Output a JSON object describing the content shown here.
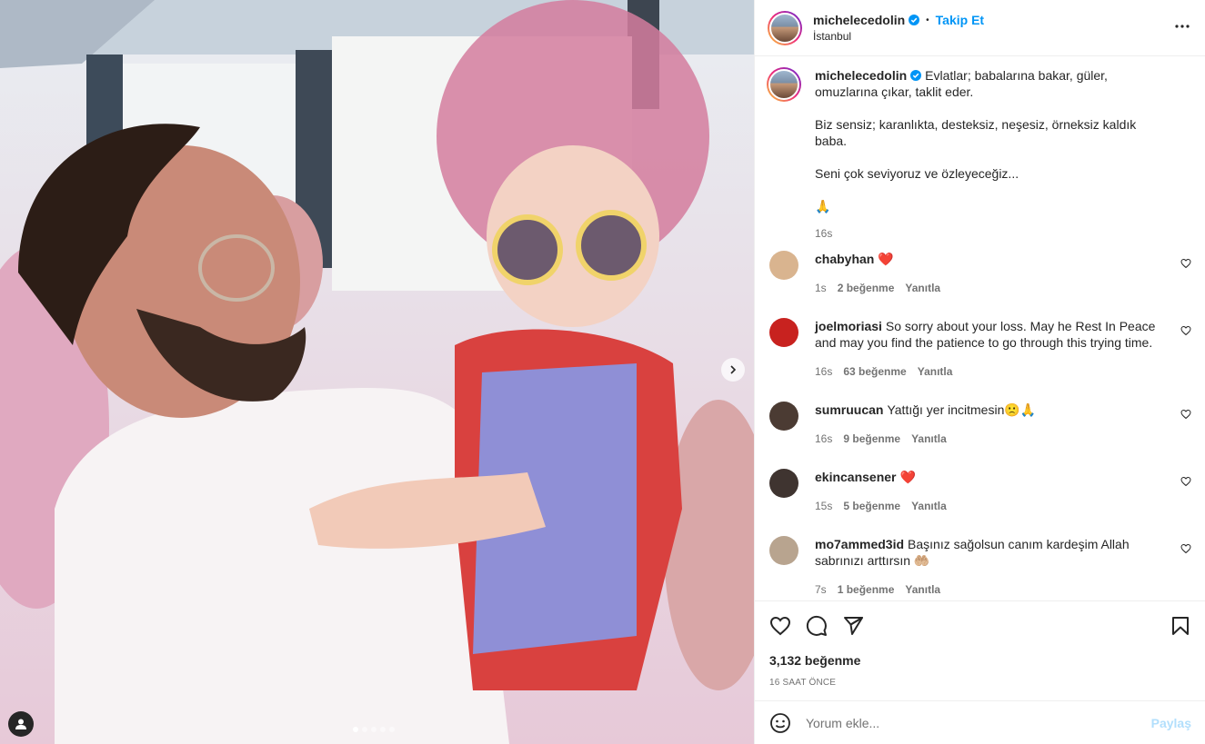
{
  "post": {
    "username": "michelecedolin",
    "follow_label": "Takip Et",
    "location": "İstanbul"
  },
  "caption": {
    "username": "michelecedolin",
    "line1": "Evlatlar; babalarına bakar, güler, omuzlarına çıkar, taklit eder.",
    "line2": "Biz sensiz; karanlıkta, desteksiz, neşesiz, örneksiz kaldık baba.",
    "line3": "Seni çok seviyoruz ve özleyeceğiz...",
    "emoji": "🙏",
    "time": "16s"
  },
  "comments": [
    {
      "username": "chabyhan",
      "text": "❤️",
      "time": "1s",
      "likes": "2 beğenme",
      "reply": "Yanıtla"
    },
    {
      "username": "joelmoriasi",
      "text": "So sorry about your loss. May he Rest In Peace and may you find the patience to go through this trying time.",
      "time": "16s",
      "likes": "63 beğenme",
      "reply": "Yanıtla"
    },
    {
      "username": "sumruucan",
      "text": "Yattığı yer incitmesin🙁🙏",
      "time": "16s",
      "likes": "9 beğenme",
      "reply": "Yanıtla"
    },
    {
      "username": "ekincansener",
      "text": "❤️",
      "time": "15s",
      "likes": "5 beğenme",
      "reply": "Yanıtla"
    },
    {
      "username": "mo7ammed3id",
      "text": "Başınız sağolsun canım kardeşim Allah sabrınızı arttırsın 🤲🏼",
      "time": "7s",
      "likes": "1 beğenme",
      "reply": "Yanıtla"
    }
  ],
  "footer": {
    "likes": "3,132 beğenme",
    "time_ago": "16 SAAT ÖNCE",
    "comment_placeholder": "Yorum ekle...",
    "post_label": "Paylaş"
  }
}
